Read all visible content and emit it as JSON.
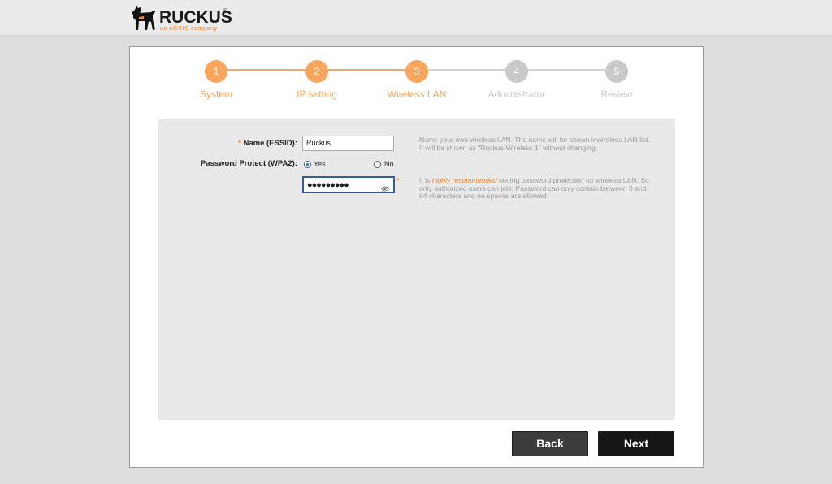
{
  "brand": {
    "name": "RUCKUS",
    "registered": "®",
    "tagline": "an ARRIS company",
    "accent_color": "#f2862a"
  },
  "steps": [
    {
      "number": "1",
      "label": "System",
      "state": "done"
    },
    {
      "number": "2",
      "label": "IP setting",
      "state": "done"
    },
    {
      "number": "3",
      "label": "Wireless LAN",
      "state": "active"
    },
    {
      "number": "4",
      "label": "Administrator",
      "state": "pending"
    },
    {
      "number": "5",
      "label": "Review",
      "state": "pending"
    }
  ],
  "colors": {
    "step_active": "#f8a65e",
    "step_pending": "#c9c9c9",
    "line_active": "#f8a65e",
    "line_pending": "#d4d4d4"
  },
  "form": {
    "required_mark": "*",
    "essid": {
      "label": "Name (ESSID):",
      "value": "Ruckus",
      "help": "Name your own wireless LAN. The name will be shown inwireless LAN list. It will be shown as \"Ruckus-Wireless 1\" without changing."
    },
    "password_protect": {
      "label": "Password Protect (WPA2):",
      "yes_label": "Yes",
      "no_label": "No",
      "selected": "Yes"
    },
    "password": {
      "masked_value": "●●●●●●●●●",
      "help_prefix": "It is ",
      "help_emphasis": "highly recommended",
      "help_suffix": " setting password protection for wireless LAN. So only authorized users can join. Password can only contain between 8 and 64 characters and no spaces are allowed."
    }
  },
  "buttons": {
    "back_label": "Back",
    "next_label": "Next"
  }
}
